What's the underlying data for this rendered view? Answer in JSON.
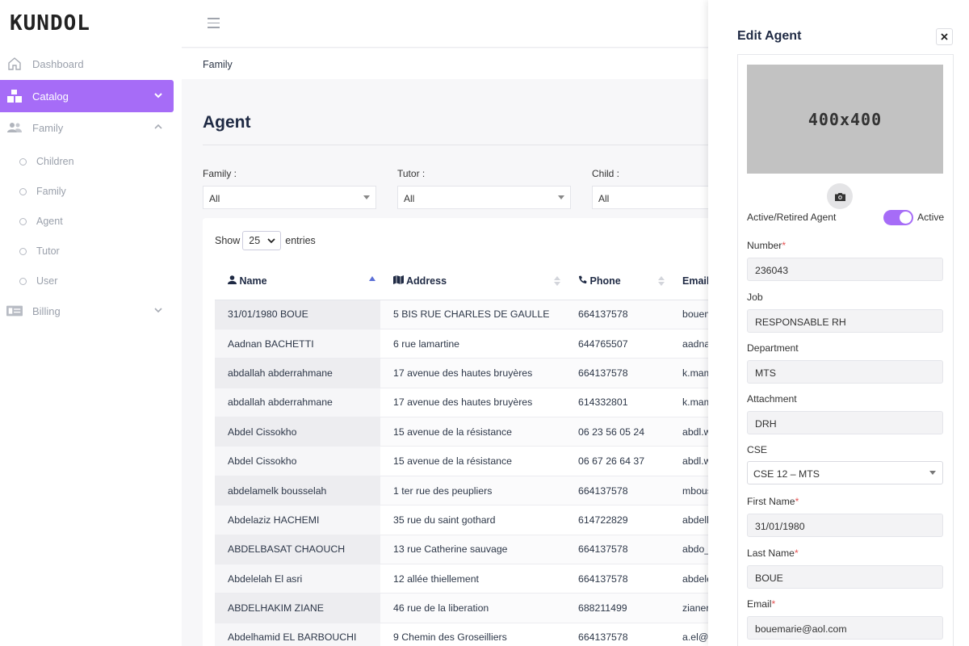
{
  "app": {
    "logo": "KUNDOL"
  },
  "sidebar": {
    "items": [
      {
        "label": "Dashboard",
        "icon": "home-icon"
      },
      {
        "label": "Catalog",
        "icon": "boxes-icon"
      },
      {
        "label": "Family",
        "icon": "users-icon"
      },
      {
        "label": "Billing",
        "icon": "billing-icon"
      }
    ],
    "sub_items": [
      "Children",
      "Family",
      "Agent",
      "Tutor",
      "User"
    ]
  },
  "breadcrumb": "Family",
  "page": {
    "title": "Agent"
  },
  "filters": [
    {
      "label": "Family :",
      "value": "All"
    },
    {
      "label": "Tutor :",
      "value": "All"
    },
    {
      "label": "Child :",
      "value": "All"
    }
  ],
  "table": {
    "show_label": "Show",
    "entries_value": "25",
    "entries_label": "entries",
    "columns": [
      "Name",
      "Address",
      "Phone",
      "Email"
    ],
    "rows": [
      [
        "31/01/1980 BOUE",
        "5 BIS RUE CHARLES DE GAULLE",
        "664137578",
        "bouem"
      ],
      [
        "Aadnan BACHETTI",
        "6 rue lamartine",
        "644765507",
        "aadna"
      ],
      [
        "abdallah abderrahmane",
        "17 avenue des hautes bruyères",
        "664137578",
        "k.mam"
      ],
      [
        "abdallah abderrahmane",
        "17 avenue des hautes bruyères",
        "614332801",
        "k.mam"
      ],
      [
        "Abdel Cissokho",
        "15 avenue de la résistance",
        "06 23 56 05 24",
        "abdl.w"
      ],
      [
        "Abdel Cissokho",
        "15 avenue de la résistance",
        "06 67 26 64 37",
        "abdl.w"
      ],
      [
        "abdelamelk bousselah",
        "1 ter rue des peupliers",
        "664137578",
        "mbous"
      ],
      [
        "Abdelaziz HACHEMI",
        "35 rue du saint gothard",
        "614722829",
        "abdelh"
      ],
      [
        "ABDELBASAT CHAOUCH",
        "13 rue Catherine sauvage",
        "664137578",
        "abdo_"
      ],
      [
        "Abdelelah El asri",
        "12 allée thiellement",
        "664137578",
        "abdele"
      ],
      [
        "ABDELHAKIM ZIANE",
        "46 rue de la liberation",
        "688211499",
        "zianer"
      ],
      [
        "Abdelhamid EL BARBOUCHI",
        "9 Chemin des Groseilliers",
        "664137578",
        "a.el@"
      ]
    ]
  },
  "drawer": {
    "title": "Edit Agent",
    "image_placeholder": "400x400",
    "toggle_label": "Active/Retired Agent",
    "toggle_state": "Active",
    "fields": {
      "number": {
        "label": "Number",
        "value": "236043"
      },
      "job": {
        "label": "Job",
        "value": "RESPONSABLE RH"
      },
      "department": {
        "label": "Department",
        "value": "MTS"
      },
      "attachment": {
        "label": "Attachment",
        "value": "DRH"
      },
      "cse": {
        "label": "CSE",
        "value": "CSE 12 – MTS"
      },
      "first_name": {
        "label": "First Name",
        "value": "31/01/1980"
      },
      "last_name": {
        "label": "Last Name",
        "value": "BOUE"
      },
      "email": {
        "label": "Email",
        "value": "bouemarie@aol.com"
      }
    },
    "required_mark": "*"
  },
  "colors": {
    "accent": "#a66cf7",
    "title": "#1f2a44"
  }
}
